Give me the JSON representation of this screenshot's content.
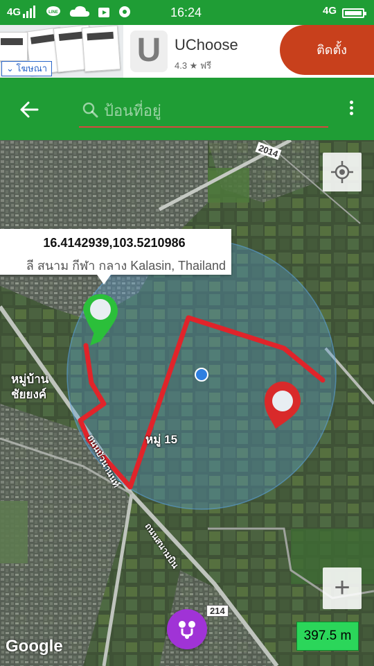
{
  "status_bar": {
    "network_left": "4G",
    "time": "16:24",
    "network_right": "4G",
    "icons": [
      "signal-icon",
      "line-icon",
      "cloud-icon",
      "play-store-icon",
      "chrome-icon",
      "battery-icon"
    ]
  },
  "ad": {
    "tag": "โฆษณา",
    "logo_letter": "U",
    "app_name": "UChoose",
    "rating": "4.3 ★ ฟรี",
    "install_label": "ติดตั้ง"
  },
  "toolbar": {
    "search_placeholder": "ป้อนที่อยู่",
    "icons": [
      "back-arrow-icon",
      "search-icon",
      "more-vert-icon"
    ]
  },
  "map": {
    "labels": {
      "road_2014": "2014",
      "village": "หมู่บ้าน\nชัยยงค์",
      "moo15": "หมู่ 15",
      "road_bottom": "214",
      "street1": "ถนนบัวนานนท์",
      "street2": "ถนนสนามบิน"
    },
    "popup": {
      "coords": "16.4142939,103.5210986",
      "address": "ลี สนาม กีฬา กลาง Kalasin, Thailand"
    },
    "distance": "397.5 m",
    "google": "Google",
    "zoom_in": "+",
    "colors": {
      "route": "#e0242a",
      "start_marker": "#2bbf3a",
      "end_marker": "#d92a2a",
      "radius_fill": "#5aa0d8",
      "current_location": "#2f7fe0"
    }
  }
}
